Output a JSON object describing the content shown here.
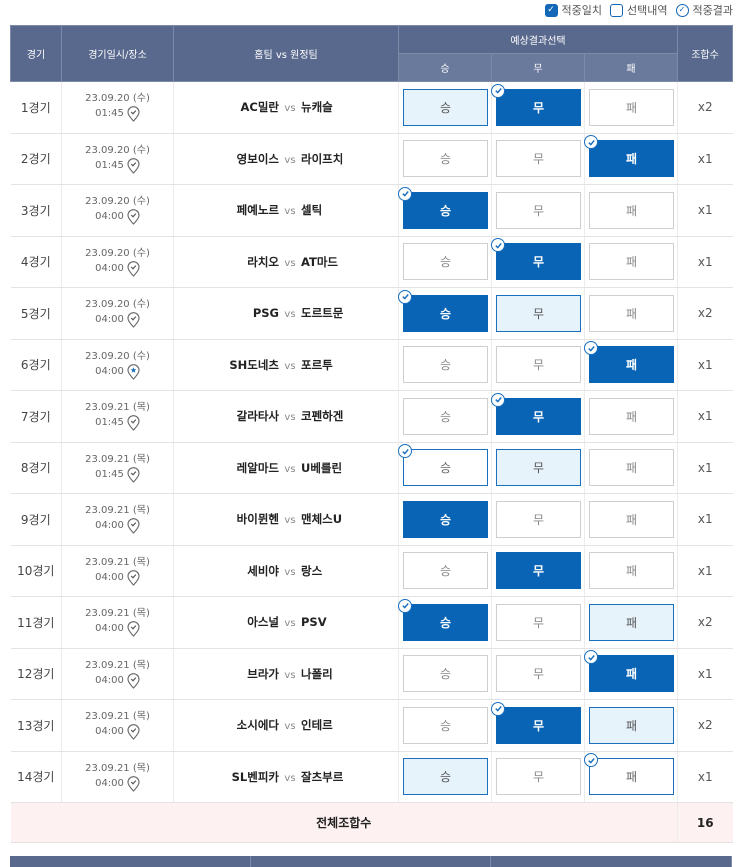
{
  "legend": {
    "hit": "적중일치",
    "selected": "선택내역",
    "result": "적중결과"
  },
  "header": {
    "no": "경기",
    "datetime": "경기일시/장소",
    "match": "홈팀 vs 원정팀",
    "prediction": "예상결과선택",
    "win": "승",
    "draw": "무",
    "lose": "패",
    "count": "조합수"
  },
  "vs_label": "vs",
  "games": [
    {
      "no": "1경기",
      "date": "23.09.20 (수)",
      "time": "01:45",
      "home": "AC밀란",
      "away": "뉴캐슬",
      "win": "light",
      "draw": "dark",
      "lose": "none",
      "mark": "draw",
      "count": "x2",
      "pin": "normal"
    },
    {
      "no": "2경기",
      "date": "23.09.20 (수)",
      "time": "01:45",
      "home": "영보이스",
      "away": "라이프치",
      "win": "none",
      "draw": "none",
      "lose": "dark",
      "mark": "lose",
      "count": "x1",
      "pin": "normal"
    },
    {
      "no": "3경기",
      "date": "23.09.20 (수)",
      "time": "04:00",
      "home": "페예노르",
      "away": "셀틱",
      "win": "dark",
      "draw": "none",
      "lose": "none",
      "mark": "win",
      "count": "x1",
      "pin": "normal"
    },
    {
      "no": "4경기",
      "date": "23.09.20 (수)",
      "time": "04:00",
      "home": "라치오",
      "away": "AT마드",
      "win": "none",
      "draw": "dark",
      "lose": "none",
      "mark": "draw",
      "count": "x1",
      "pin": "normal"
    },
    {
      "no": "5경기",
      "date": "23.09.20 (수)",
      "time": "04:00",
      "home": "PSG",
      "away": "도르트문",
      "win": "dark",
      "draw": "light",
      "lose": "none",
      "mark": "win",
      "count": "x2",
      "pin": "normal"
    },
    {
      "no": "6경기",
      "date": "23.09.20 (수)",
      "time": "04:00",
      "home": "SH도네츠",
      "away": "포르투",
      "win": "none",
      "draw": "none",
      "lose": "dark",
      "mark": "lose",
      "count": "x1",
      "pin": "star"
    },
    {
      "no": "7경기",
      "date": "23.09.21 (목)",
      "time": "01:45",
      "home": "갈라타사",
      "away": "코펜하겐",
      "win": "none",
      "draw": "dark",
      "lose": "none",
      "mark": "draw",
      "count": "x1",
      "pin": "normal"
    },
    {
      "no": "8경기",
      "date": "23.09.21 (목)",
      "time": "01:45",
      "home": "레알마드",
      "away": "U베를린",
      "win": "hitonly",
      "draw": "light",
      "lose": "none",
      "mark": "win",
      "count": "x1",
      "pin": "normal"
    },
    {
      "no": "9경기",
      "date": "23.09.21 (목)",
      "time": "04:00",
      "home": "바이뮌헨",
      "away": "맨체스U",
      "win": "dark",
      "draw": "none",
      "lose": "none",
      "mark": "",
      "count": "x1",
      "pin": "normal"
    },
    {
      "no": "10경기",
      "date": "23.09.21 (목)",
      "time": "04:00",
      "home": "세비야",
      "away": "랑스",
      "win": "none",
      "draw": "dark",
      "lose": "none",
      "mark": "",
      "count": "x1",
      "pin": "normal"
    },
    {
      "no": "11경기",
      "date": "23.09.21 (목)",
      "time": "04:00",
      "home": "아스널",
      "away": "PSV",
      "win": "dark",
      "draw": "none",
      "lose": "light",
      "mark": "win",
      "count": "x2",
      "pin": "normal"
    },
    {
      "no": "12경기",
      "date": "23.09.21 (목)",
      "time": "04:00",
      "home": "브라가",
      "away": "나폴리",
      "win": "none",
      "draw": "none",
      "lose": "dark",
      "mark": "lose",
      "count": "x1",
      "pin": "normal"
    },
    {
      "no": "13경기",
      "date": "23.09.21 (목)",
      "time": "04:00",
      "home": "소시에다",
      "away": "인테르",
      "win": "none",
      "draw": "dark",
      "lose": "light",
      "mark": "draw",
      "count": "x2",
      "pin": "normal"
    },
    {
      "no": "14경기",
      "date": "23.09.21 (목)",
      "time": "04:00",
      "home": "SL벤피카",
      "away": "잘츠부르",
      "win": "light",
      "draw": "none",
      "lose": "hitonly",
      "mark": "lose",
      "count": "x1",
      "pin": "normal"
    }
  ],
  "total": {
    "label": "전체조합수",
    "value": "16"
  },
  "colors": {
    "header_bg": "#59698e",
    "selected_dark": "#0a64b5",
    "selected_light": "#e6f3fb",
    "total_bg": "#fdf1f1"
  },
  "icons": {
    "check": "check-circle-icon",
    "location": "location-pin-icon",
    "location_star": "location-pin-star-icon"
  }
}
